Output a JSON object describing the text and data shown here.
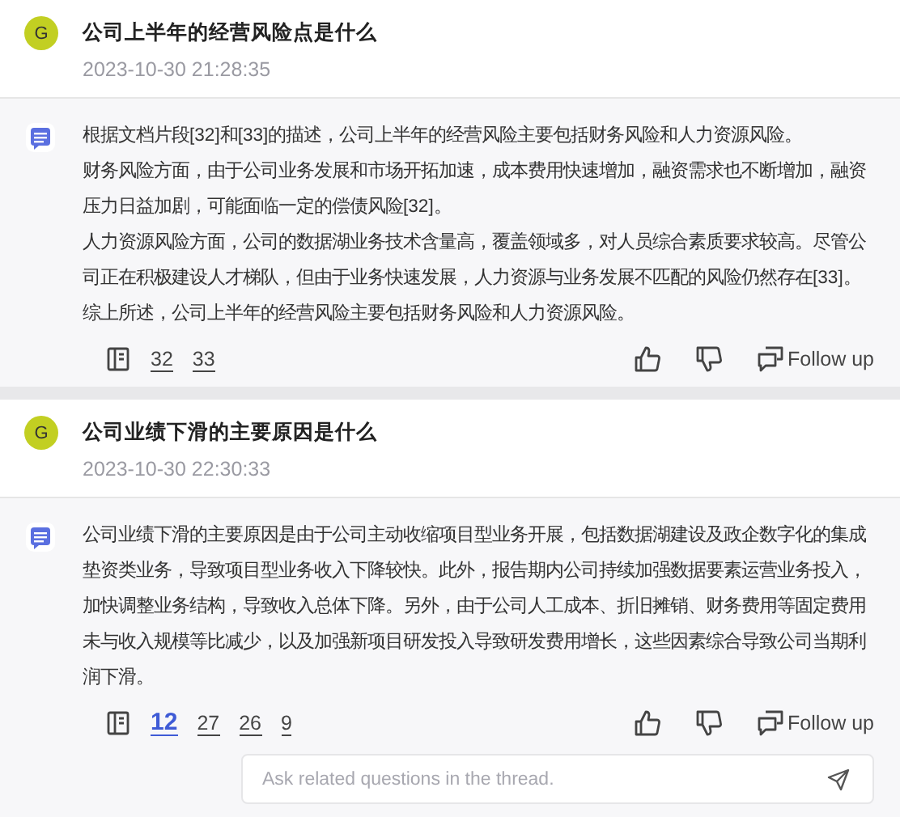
{
  "threads": [
    {
      "question": "公司上半年的经营风险点是什么",
      "avatar": "G",
      "time": "2023-10-30 21:28:35",
      "paragraphs": [
        "根据文档片段[32]和[33]的描述，公司上半年的经营风险主要包括财务风险和人力资源风险。",
        "财务风险方面，由于公司业务发展和市场开拓加速，成本费用快速增加，融资需求也不断增加，融资压力日益加剧，可能面临一定的偿债风险[32]。",
        "人力资源风险方面，公司的数据湖业务技术含量高，覆盖领域多，对人员综合素质要求较高。尽管公司正在积极建设人才梯队，但由于业务快速发展，人力资源与业务发展不匹配的风险仍然存在[33]。",
        "综上所述，公司上半年的经营风险主要包括财务风险和人力资源风险。"
      ],
      "sources": [
        {
          "label": "32",
          "selected": false
        },
        {
          "label": "33",
          "selected": false
        }
      ],
      "follow_up": "Follow up"
    },
    {
      "question": "公司业绩下滑的主要原因是什么",
      "avatar": "G",
      "time": "2023-10-30 22:30:33",
      "paragraphs": [
        "公司业绩下滑的主要原因是由于公司主动收缩项目型业务开展，包括数据湖建设及政企数字化的集成垫资类业务，导致项目型业务收入下降较快。此外，报告期内公司持续加强数据要素运营业务投入，加快调整业务结构，导致收入总体下降。另外，由于公司人工成本、折旧摊销、财务费用等固定费用未与收入规模等比减少，以及加强新项目研发投入导致研发费用增长，这些因素综合导致公司当期利润下滑。"
      ],
      "sources": [
        {
          "label": "12",
          "selected": true
        },
        {
          "label": "27",
          "selected": false
        },
        {
          "label": "26",
          "selected": false
        },
        {
          "label": "9",
          "selected": false
        }
      ],
      "follow_up": "Follow up",
      "followup_input": {
        "placeholder": "Ask related questions in the thread."
      }
    }
  ]
}
